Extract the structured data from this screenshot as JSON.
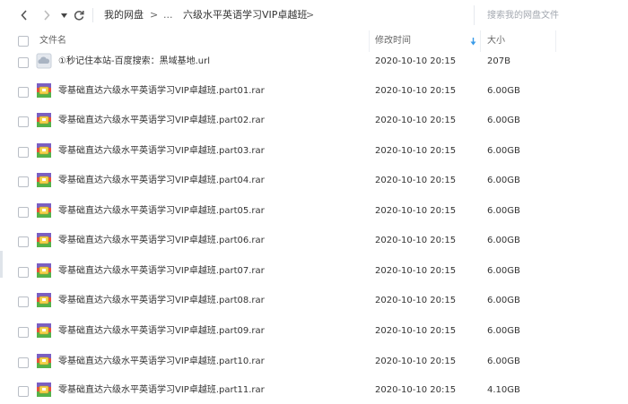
{
  "toolbar": {
    "back_icon": "chevron-left-icon",
    "forward_icon": "chevron-right-icon",
    "dropdown_icon": "caret-down-icon",
    "refresh_icon": "refresh-icon",
    "breadcrumb": [
      "我的网盘",
      ">",
      "...",
      "六级水平英语学习VIP卓越班",
      ">"
    ],
    "search_placeholder": "搜索我的网盘文件"
  },
  "columns": {
    "name": "文件名",
    "modified": "修改时间",
    "size": "大小",
    "sort_icon": "sort-down-arrow-icon",
    "sort_color": "#3a9be8"
  },
  "files": [
    {
      "name": "①秒记住本站-百度搜索：黑域基地.url",
      "modified": "2020-10-10 20:15",
      "size": "207B",
      "icon": "url-file-icon"
    },
    {
      "name": "零基础直达六级水平英语学习VIP卓越班.part01.rar",
      "modified": "2020-10-10 20:15",
      "size": "6.00GB",
      "icon": "rar-archive-icon"
    },
    {
      "name": "零基础直达六级水平英语学习VIP卓越班.part02.rar",
      "modified": "2020-10-10 20:15",
      "size": "6.00GB",
      "icon": "rar-archive-icon"
    },
    {
      "name": "零基础直达六级水平英语学习VIP卓越班.part03.rar",
      "modified": "2020-10-10 20:15",
      "size": "6.00GB",
      "icon": "rar-archive-icon"
    },
    {
      "name": "零基础直达六级水平英语学习VIP卓越班.part04.rar",
      "modified": "2020-10-10 20:15",
      "size": "6.00GB",
      "icon": "rar-archive-icon"
    },
    {
      "name": "零基础直达六级水平英语学习VIP卓越班.part05.rar",
      "modified": "2020-10-10 20:15",
      "size": "6.00GB",
      "icon": "rar-archive-icon"
    },
    {
      "name": "零基础直达六级水平英语学习VIP卓越班.part06.rar",
      "modified": "2020-10-10 20:15",
      "size": "6.00GB",
      "icon": "rar-archive-icon"
    },
    {
      "name": "零基础直达六级水平英语学习VIP卓越班.part07.rar",
      "modified": "2020-10-10 20:15",
      "size": "6.00GB",
      "icon": "rar-archive-icon"
    },
    {
      "name": "零基础直达六级水平英语学习VIP卓越班.part08.rar",
      "modified": "2020-10-10 20:15",
      "size": "6.00GB",
      "icon": "rar-archive-icon"
    },
    {
      "name": "零基础直达六级水平英语学习VIP卓越班.part09.rar",
      "modified": "2020-10-10 20:15",
      "size": "6.00GB",
      "icon": "rar-archive-icon"
    },
    {
      "name": "零基础直达六级水平英语学习VIP卓越班.part10.rar",
      "modified": "2020-10-10 20:15",
      "size": "6.00GB",
      "icon": "rar-archive-icon"
    },
    {
      "name": "零基础直达六级水平英语学习VIP卓越班.part11.rar",
      "modified": "2020-10-10 20:15",
      "size": "4.10GB",
      "icon": "rar-archive-icon"
    }
  ]
}
